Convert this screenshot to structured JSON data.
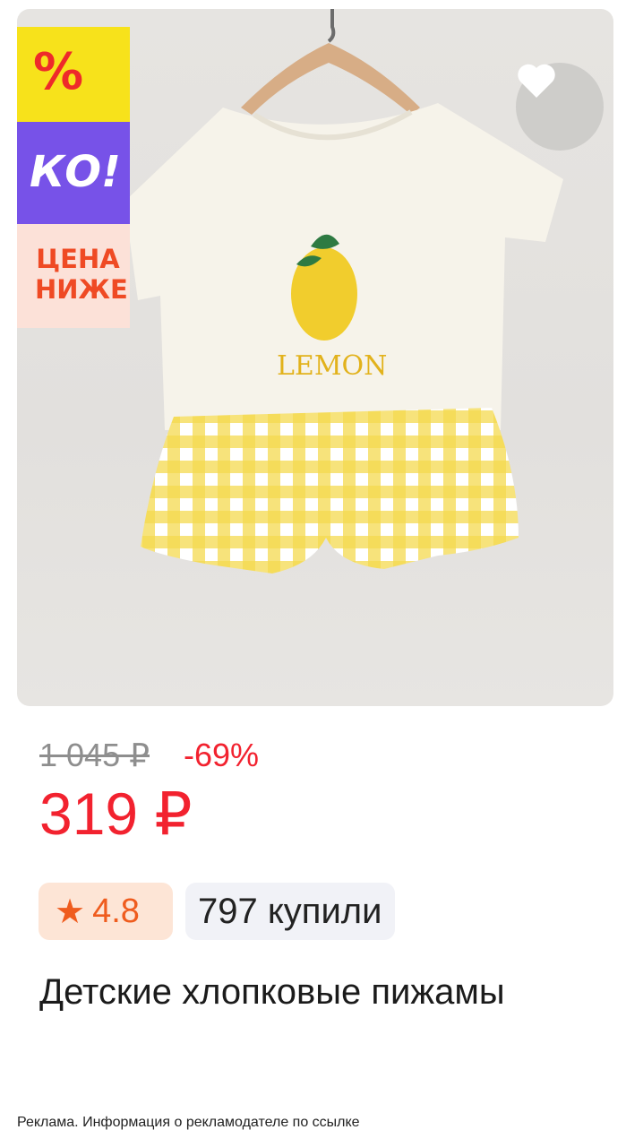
{
  "product": {
    "title": "Детские хлопковые пижамы",
    "old_price": "1 045 ₽",
    "discount": "-69%",
    "price": "319 ₽",
    "rating": "4.8",
    "purchases": "797 купили"
  },
  "promo_badge": {
    "percent": "%",
    "brand": "КО!",
    "line1": "ЦЕНА",
    "line2": "НИЖЕ"
  },
  "product_image": {
    "print_text": "LEMON"
  },
  "icons": {
    "favorite": "heart-icon",
    "rating": "star-icon"
  },
  "colors": {
    "price": "#f2222f",
    "rating": "#ef5c1e",
    "badge_yellow": "#f7e21b",
    "badge_purple": "#7752e8"
  },
  "footer": {
    "ad_disclaimer": "Реклама. Информация о рекламодателе по ссылке"
  }
}
